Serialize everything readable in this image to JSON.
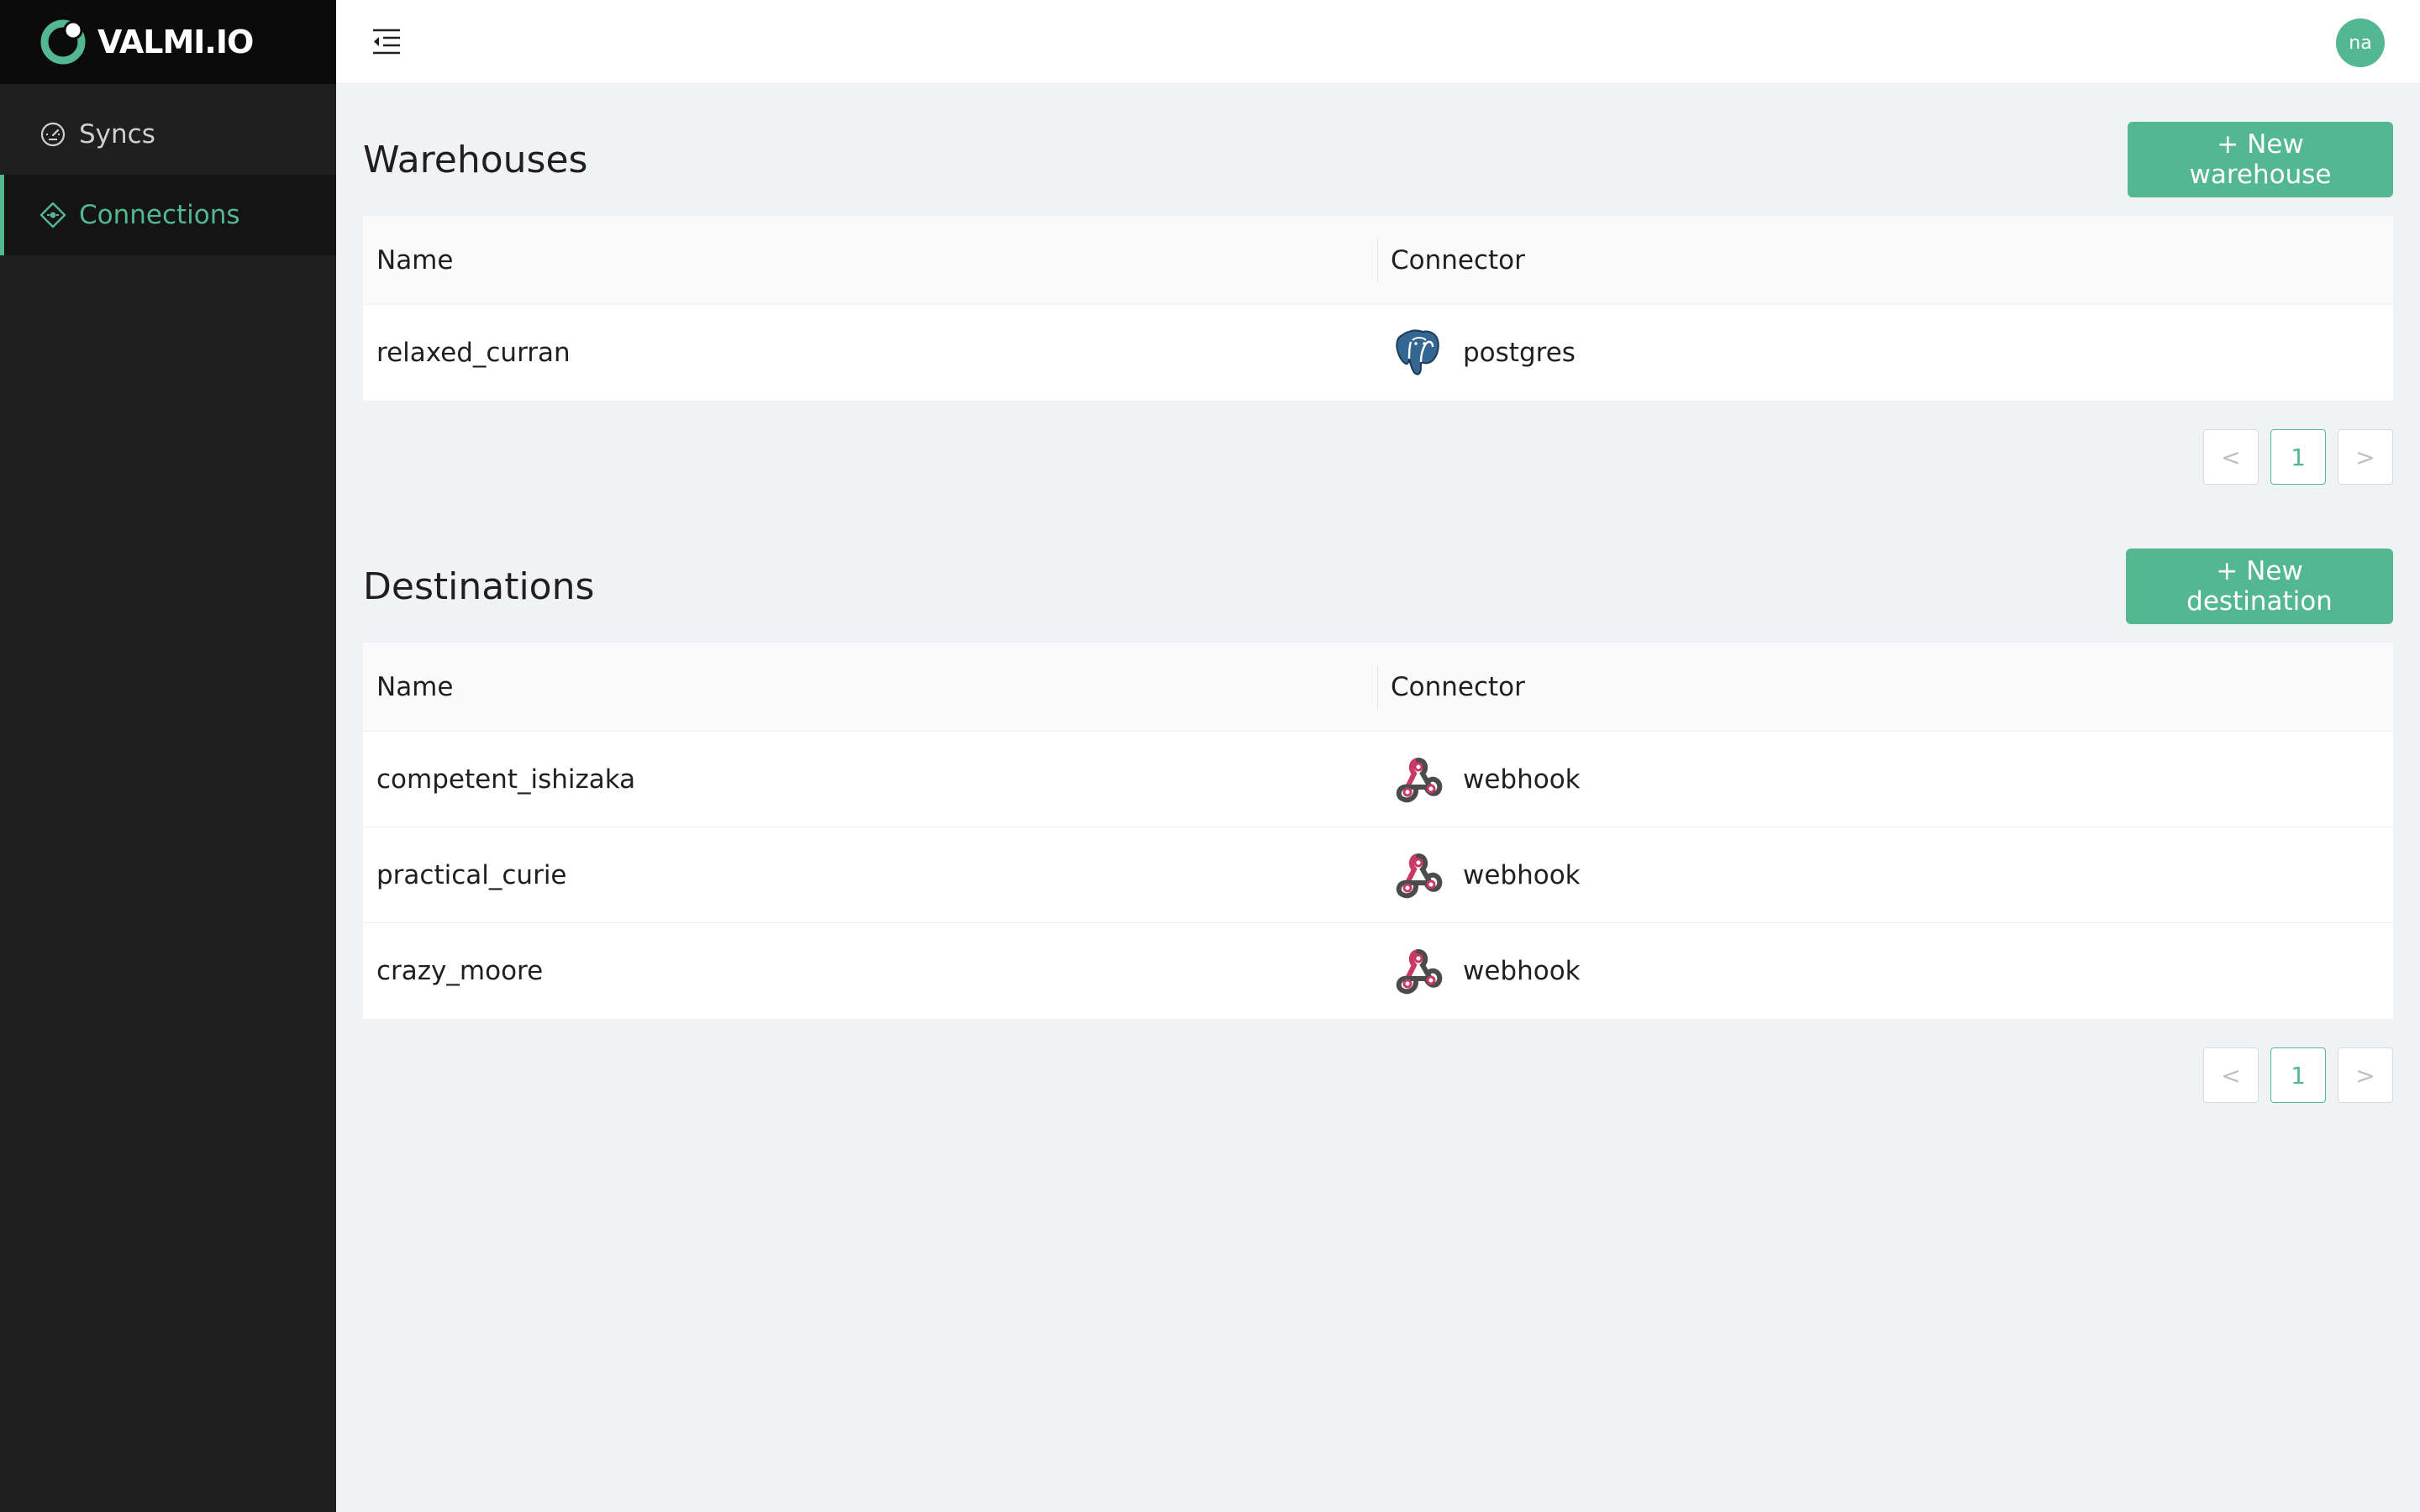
{
  "brand": {
    "name": "VALMI.IO",
    "accent": "#53b892"
  },
  "sidebar": {
    "items": [
      {
        "label": "Syncs",
        "icon": "dashboard-gauge-icon",
        "active": false
      },
      {
        "label": "Connections",
        "icon": "connections-diamond-icon",
        "active": true
      }
    ]
  },
  "header": {
    "avatar_initials": "na",
    "menu_icon": "menu-fold-icon"
  },
  "warehouses": {
    "title": "Warehouses",
    "new_button": "+ New warehouse",
    "columns": [
      "Name",
      "Connector"
    ],
    "rows": [
      {
        "name": "relaxed_curran",
        "connector": "postgres",
        "icon": "postgres-elephant-icon"
      }
    ],
    "pagination": {
      "prev": "<",
      "page": "1",
      "next": ">"
    }
  },
  "destinations": {
    "title": "Destinations",
    "new_button": "+ New destination",
    "columns": [
      "Name",
      "Connector"
    ],
    "rows": [
      {
        "name": "competent_ishizaka",
        "connector": "webhook",
        "icon": "webhook-icon"
      },
      {
        "name": "practical_curie",
        "connector": "webhook",
        "icon": "webhook-icon"
      },
      {
        "name": "crazy_moore",
        "connector": "webhook",
        "icon": "webhook-icon"
      }
    ],
    "pagination": {
      "prev": "<",
      "page": "1",
      "next": ">"
    }
  }
}
